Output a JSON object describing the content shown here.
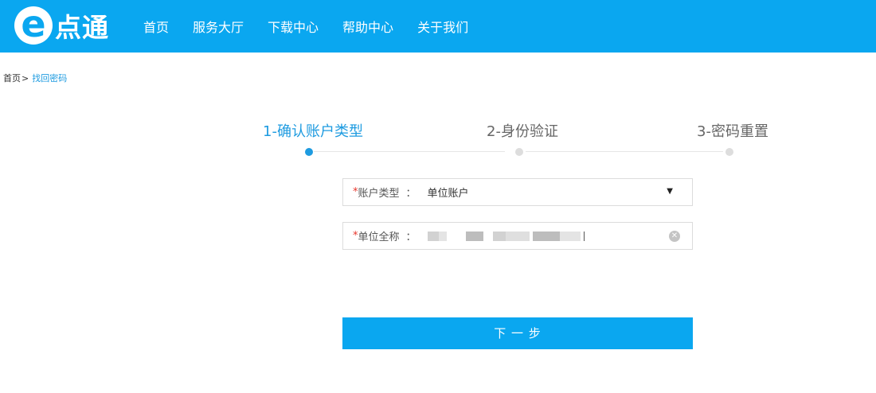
{
  "header": {
    "logo": {
      "mark": "e",
      "text": "点通"
    },
    "nav": [
      "首页",
      "服务大厅",
      "下载中心",
      "帮助中心",
      "关于我们"
    ]
  },
  "breadcrumb": {
    "home": "首页",
    "separator": ">",
    "current": "找回密码"
  },
  "steps": [
    {
      "label": "1-确认账户类型",
      "active": true
    },
    {
      "label": "2-身份验证",
      "active": false
    },
    {
      "label": "3-密码重置",
      "active": false
    }
  ],
  "form": {
    "account_type": {
      "required": "*",
      "label": "账户类型",
      "colon": "：",
      "value": "单位账户"
    },
    "org_name": {
      "required": "*",
      "label": "单位全称",
      "colon": "："
    }
  },
  "next_button": "下 一 步",
  "colors": {
    "primary": "#0aa7f0",
    "link": "#1e9be0",
    "required": "#e8362c",
    "inactive_dot": "#dddddd"
  },
  "icons": {
    "select_caret": "▼",
    "clear": "✕"
  }
}
